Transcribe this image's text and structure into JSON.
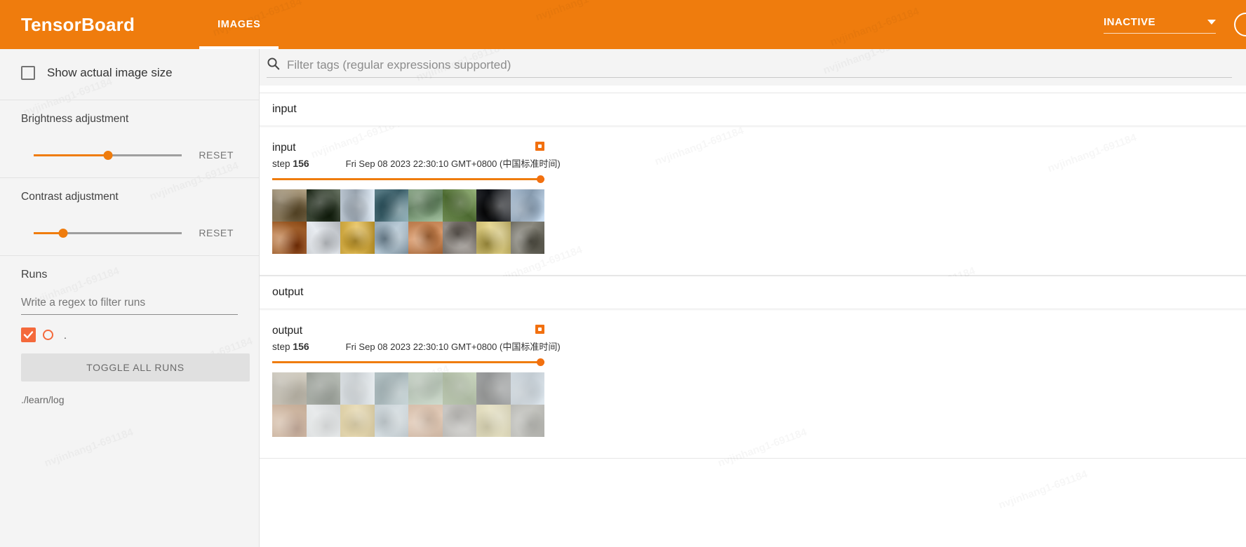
{
  "appbar": {
    "brand": "TensorBoard",
    "tabs": [
      {
        "label": "IMAGES",
        "active": true
      }
    ],
    "status": "INACTIVE",
    "caret_icon": "chevron-down-icon",
    "refresh_icon": "refresh-circle-icon",
    "accent_color": "#ef7c0d"
  },
  "sidebar": {
    "show_actual_size": {
      "label": "Show actual image size",
      "checked": false
    },
    "brightness": {
      "title": "Brightness adjustment",
      "reset_label": "RESET",
      "value_pct": 50
    },
    "contrast": {
      "title": "Contrast adjustment",
      "reset_label": "RESET",
      "value_pct": 20
    },
    "runs": {
      "title": "Runs",
      "filter_placeholder": "Write a regex to filter runs",
      "filter_value": "",
      "items": [
        {
          "name": ".",
          "checked": true,
          "color": "#f4693b"
        }
      ],
      "toggle_all_label": "TOGGLE ALL RUNS",
      "logdir": "./learn/log"
    }
  },
  "filter": {
    "search_icon": "search-icon",
    "placeholder": "Filter tags (regular expressions supported)",
    "value": ""
  },
  "tag_groups": [
    {
      "header": "input",
      "card": {
        "title": "input",
        "step_label": "step",
        "step_value": "156",
        "timestamp": "Fri Sep 08 2023 22:30:10 GMT+0800 (中国标准时间)",
        "pin_icon": "pin-square-icon",
        "slider_pos_pct": 100,
        "faded": false,
        "thumbnails": [
          [
            "#8a7a5d",
            "#3f4a3a",
            "#b9c4cf",
            "#5c7f89",
            "#7d9b7a",
            "#6e8b52",
            "#2d2f33",
            "#a8bcd0"
          ],
          [
            "#a05f2b",
            "#c9cdd2",
            "#c8a23d",
            "#94a7b4",
            "#b9794a",
            "#76706a",
            "#c6b66c",
            "#6c6a60"
          ]
        ],
        "thumbnails_row1_b": [
          "#6f5f45",
          "#2b3229",
          "#9fb0bd",
          "#4a6d78",
          "#6a8a69",
          "#5d7a44",
          "#1f2126",
          "#93a8bd"
        ],
        "thumbnails_row2_b": [
          "#8a4f1e",
          "#b4b9bf",
          "#b08a28",
          "#7f929f",
          "#a26639",
          "#615c57",
          "#b3a258",
          "#58564e"
        ]
      }
    },
    {
      "header": "output",
      "card": {
        "title": "output",
        "step_label": "step",
        "step_value": "156",
        "timestamp": "Fri Sep 08 2023 22:30:10 GMT+0800 (中国标准时间)",
        "pin_icon": "pin-square-icon",
        "slider_pos_pct": 100,
        "faded": true,
        "thumbnails": [
          [
            "#8a7a5d",
            "#3f4a3a",
            "#b9c4cf",
            "#5c7f89",
            "#7d9b7a",
            "#6e8b52",
            "#2d2f33",
            "#a8bcd0"
          ],
          [
            "#a05f2b",
            "#c9cdd2",
            "#c8a23d",
            "#94a7b4",
            "#b9794a",
            "#76706a",
            "#c6b66c",
            "#6c6a60"
          ]
        ]
      }
    }
  ],
  "watermarks": [
    "nvjinhang1-691184"
  ]
}
